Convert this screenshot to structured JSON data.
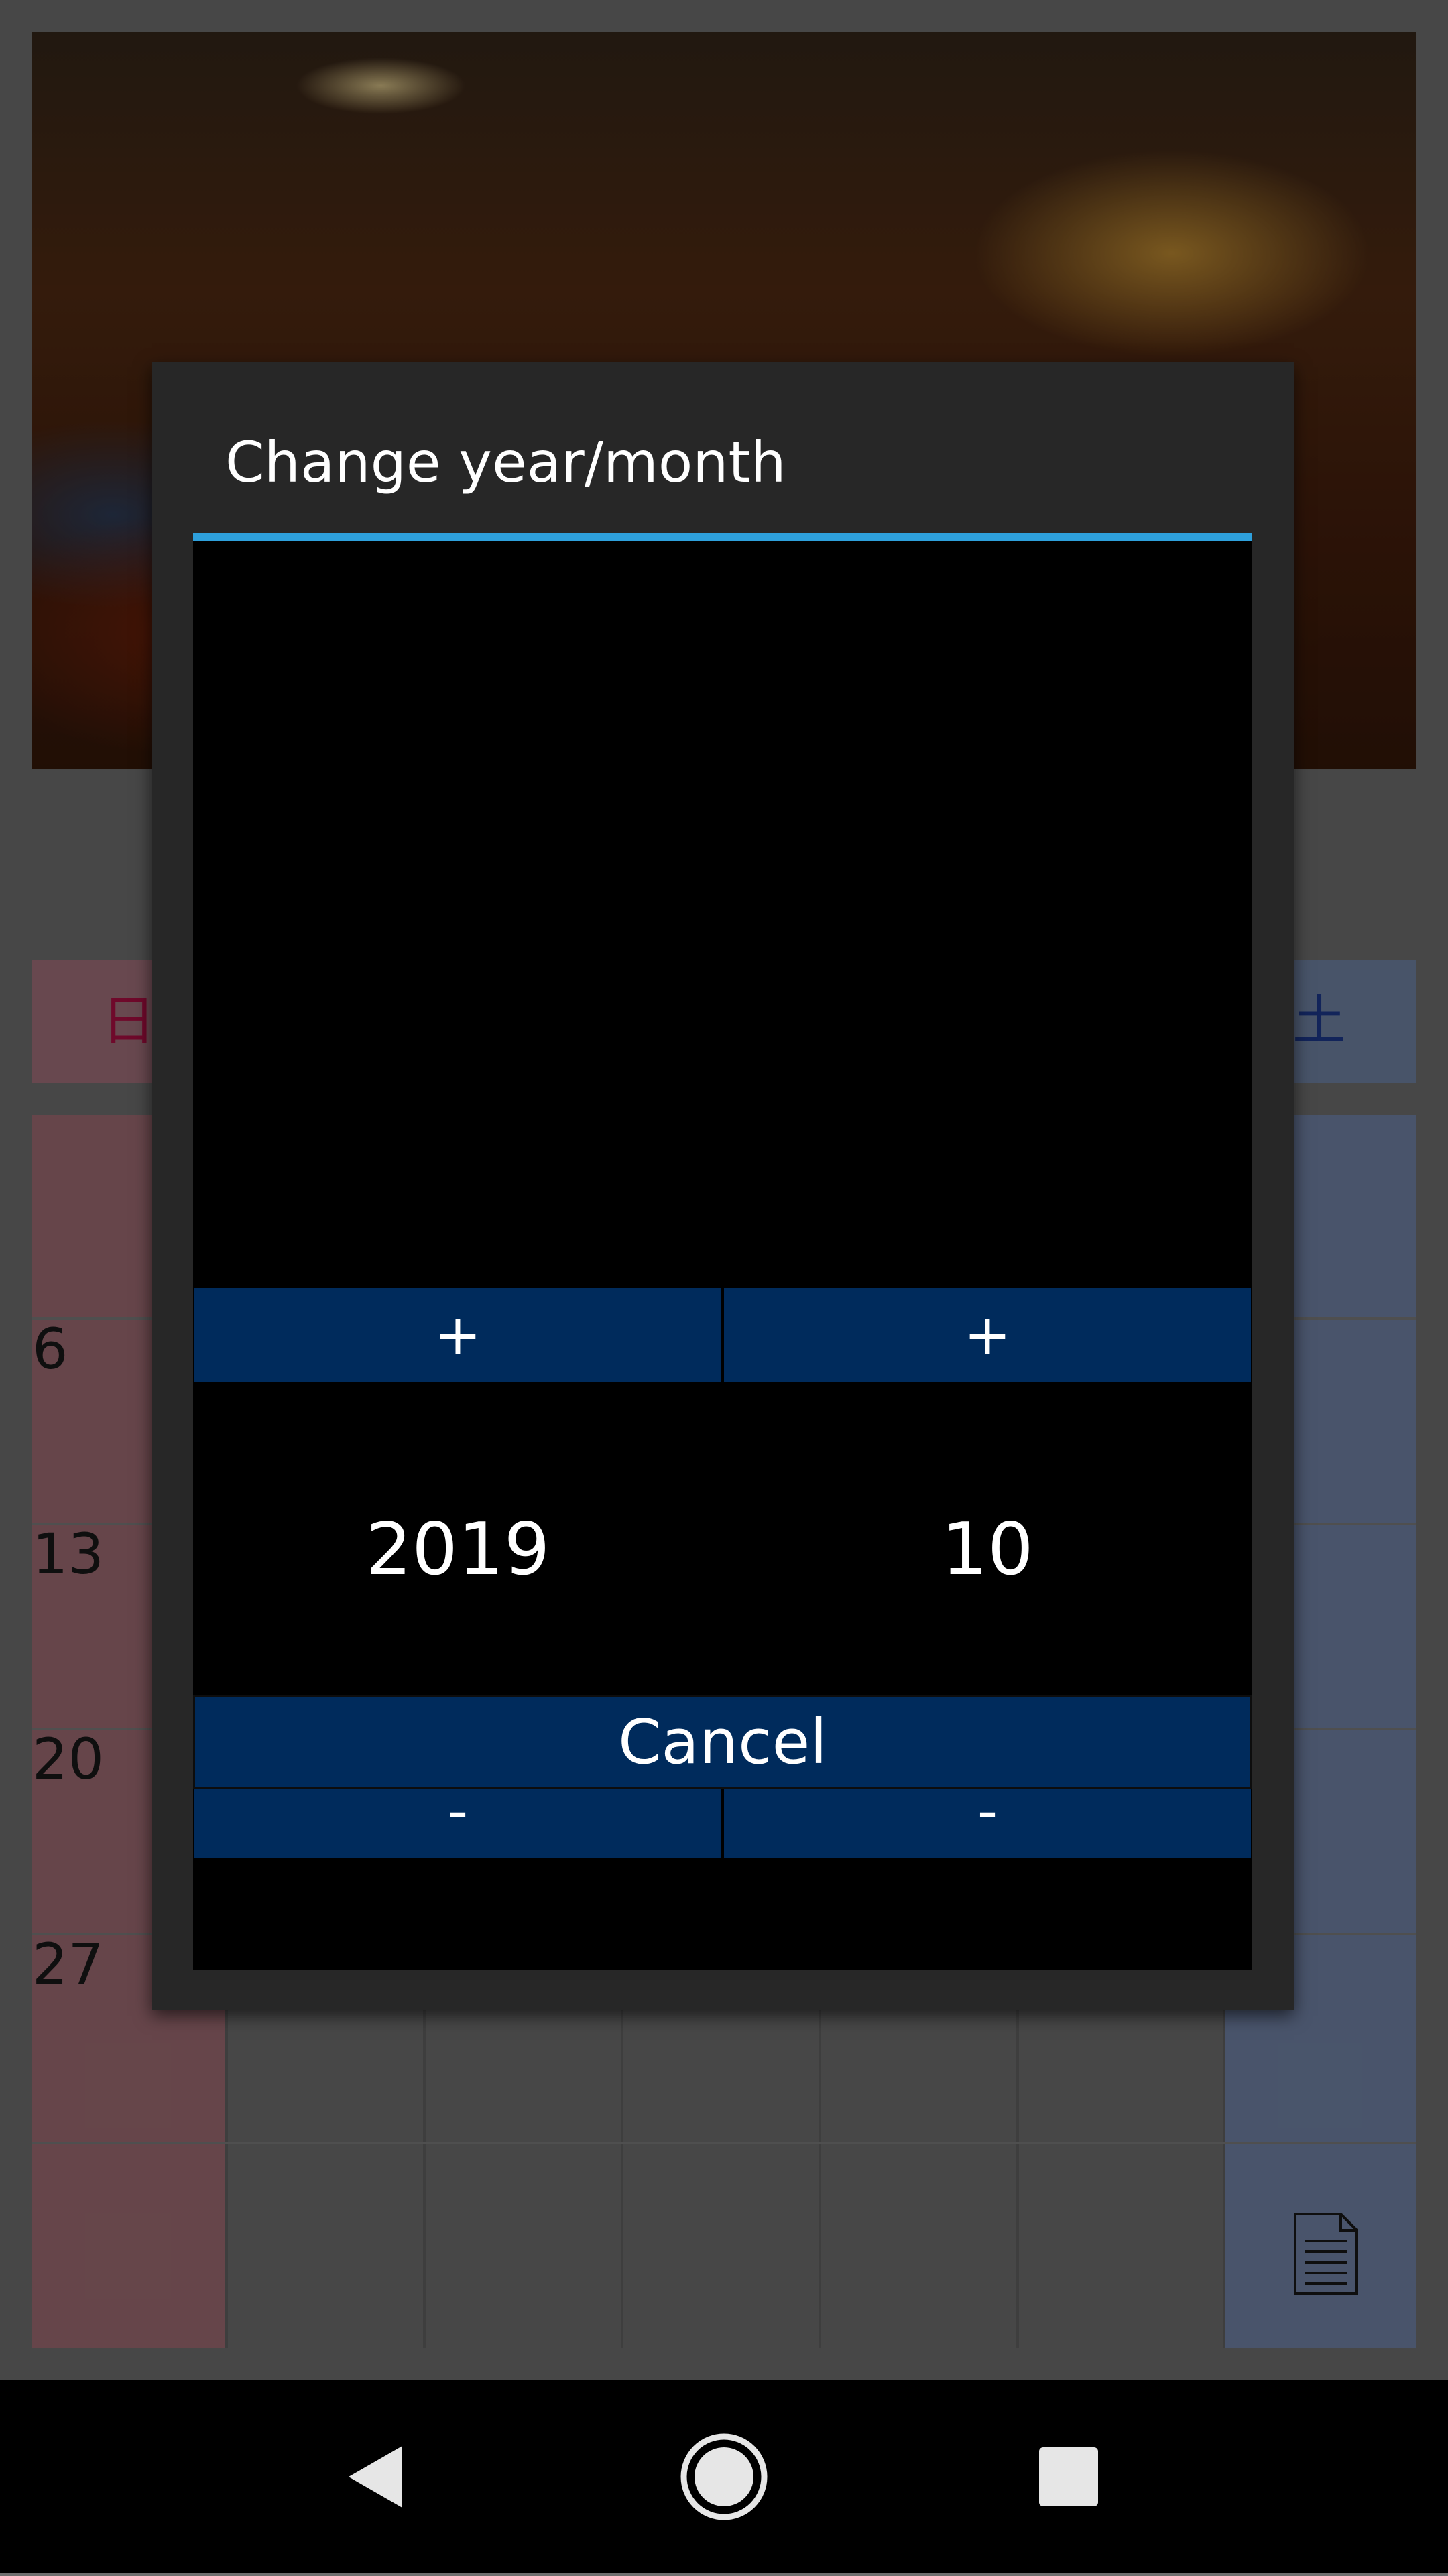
{
  "background": {
    "weekdays": {
      "sunday": "日",
      "saturday": "土"
    },
    "day_numbers": [
      "6",
      "13",
      "20",
      "27"
    ]
  },
  "dialog": {
    "title": "Change year/month",
    "year": {
      "plus_label": "+",
      "value": "2019",
      "minus_label": "-"
    },
    "month": {
      "plus_label": "+",
      "value": "10",
      "minus_label": "-"
    },
    "cancel_label": "Cancel"
  },
  "colors": {
    "accent": "#2ea0dc",
    "button": "#002b5c",
    "dialog": "#272727"
  },
  "navbar": {
    "icons": [
      "back-icon",
      "home-icon",
      "recent-apps-icon"
    ]
  }
}
